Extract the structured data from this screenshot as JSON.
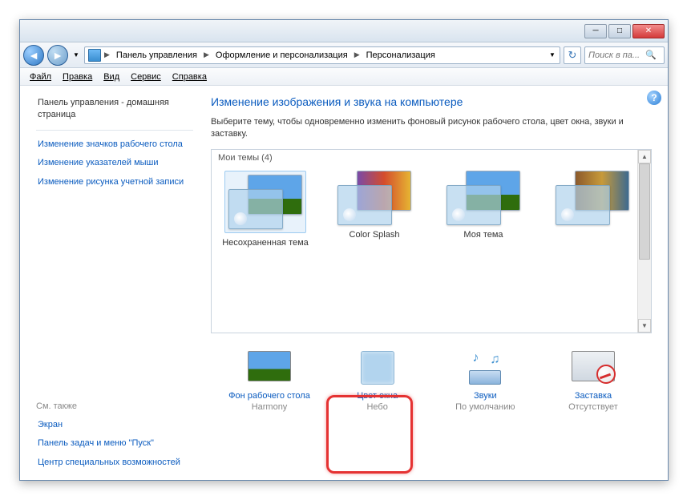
{
  "breadcrumb": {
    "items": [
      "Панель управления",
      "Оформление и персонализация",
      "Персонализация"
    ]
  },
  "search": {
    "placeholder": "Поиск в па..."
  },
  "menu": {
    "file": "Файл",
    "edit": "Правка",
    "view": "Вид",
    "tools": "Сервис",
    "help": "Справка"
  },
  "sidebar": {
    "home": "Панель управления - домашняя страница",
    "links": [
      "Изменение значков рабочего стола",
      "Изменение указателей мыши",
      "Изменение рисунка учетной записи"
    ],
    "see_also_head": "См. также",
    "see_also": [
      "Экран",
      "Панель задач и меню \"Пуск\"",
      "Центр специальных возможностей"
    ]
  },
  "main": {
    "title": "Изменение изображения и звука на компьютере",
    "desc": "Выберите тему, чтобы одновременно изменить фоновый рисунок рабочего стола, цвет окна, звуки и заставку.",
    "themes_head": "Мои темы (4)",
    "themes": [
      {
        "label": "Несохраненная тема"
      },
      {
        "label": "Color Splash"
      },
      {
        "label": "Моя тема"
      },
      {
        "label": ""
      }
    ]
  },
  "bottom": {
    "bg": {
      "label": "Фон рабочего стола",
      "sub": "Harmony"
    },
    "color": {
      "label": "Цвет окна",
      "sub": "Небо"
    },
    "sound": {
      "label": "Звуки",
      "sub": "По умолчанию"
    },
    "saver": {
      "label": "Заставка",
      "sub": "Отсутствует"
    }
  }
}
